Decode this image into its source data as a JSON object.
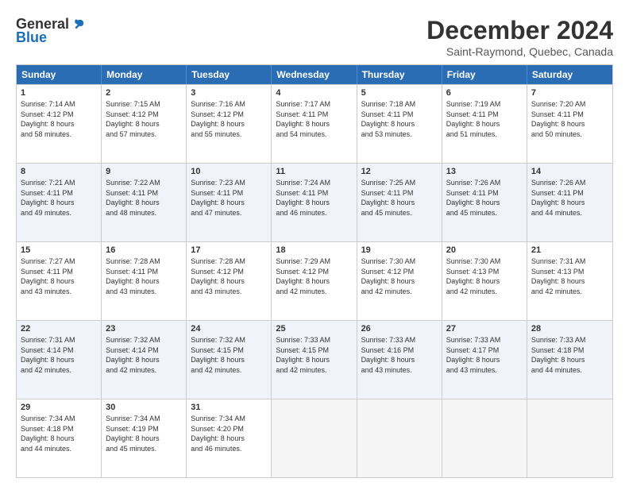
{
  "logo": {
    "general": "General",
    "blue": "Blue"
  },
  "title": "December 2024",
  "location": "Saint-Raymond, Quebec, Canada",
  "header_days": [
    "Sunday",
    "Monday",
    "Tuesday",
    "Wednesday",
    "Thursday",
    "Friday",
    "Saturday"
  ],
  "weeks": [
    [
      {
        "day": "1",
        "lines": [
          "Sunrise: 7:14 AM",
          "Sunset: 4:12 PM",
          "Daylight: 8 hours",
          "and 58 minutes."
        ]
      },
      {
        "day": "2",
        "lines": [
          "Sunrise: 7:15 AM",
          "Sunset: 4:12 PM",
          "Daylight: 8 hours",
          "and 57 minutes."
        ]
      },
      {
        "day": "3",
        "lines": [
          "Sunrise: 7:16 AM",
          "Sunset: 4:12 PM",
          "Daylight: 8 hours",
          "and 55 minutes."
        ]
      },
      {
        "day": "4",
        "lines": [
          "Sunrise: 7:17 AM",
          "Sunset: 4:11 PM",
          "Daylight: 8 hours",
          "and 54 minutes."
        ]
      },
      {
        "day": "5",
        "lines": [
          "Sunrise: 7:18 AM",
          "Sunset: 4:11 PM",
          "Daylight: 8 hours",
          "and 53 minutes."
        ]
      },
      {
        "day": "6",
        "lines": [
          "Sunrise: 7:19 AM",
          "Sunset: 4:11 PM",
          "Daylight: 8 hours",
          "and 51 minutes."
        ]
      },
      {
        "day": "7",
        "lines": [
          "Sunrise: 7:20 AM",
          "Sunset: 4:11 PM",
          "Daylight: 8 hours",
          "and 50 minutes."
        ]
      }
    ],
    [
      {
        "day": "8",
        "lines": [
          "Sunrise: 7:21 AM",
          "Sunset: 4:11 PM",
          "Daylight: 8 hours",
          "and 49 minutes."
        ]
      },
      {
        "day": "9",
        "lines": [
          "Sunrise: 7:22 AM",
          "Sunset: 4:11 PM",
          "Daylight: 8 hours",
          "and 48 minutes."
        ]
      },
      {
        "day": "10",
        "lines": [
          "Sunrise: 7:23 AM",
          "Sunset: 4:11 PM",
          "Daylight: 8 hours",
          "and 47 minutes."
        ]
      },
      {
        "day": "11",
        "lines": [
          "Sunrise: 7:24 AM",
          "Sunset: 4:11 PM",
          "Daylight: 8 hours",
          "and 46 minutes."
        ]
      },
      {
        "day": "12",
        "lines": [
          "Sunrise: 7:25 AM",
          "Sunset: 4:11 PM",
          "Daylight: 8 hours",
          "and 45 minutes."
        ]
      },
      {
        "day": "13",
        "lines": [
          "Sunrise: 7:26 AM",
          "Sunset: 4:11 PM",
          "Daylight: 8 hours",
          "and 45 minutes."
        ]
      },
      {
        "day": "14",
        "lines": [
          "Sunrise: 7:26 AM",
          "Sunset: 4:11 PM",
          "Daylight: 8 hours",
          "and 44 minutes."
        ]
      }
    ],
    [
      {
        "day": "15",
        "lines": [
          "Sunrise: 7:27 AM",
          "Sunset: 4:11 PM",
          "Daylight: 8 hours",
          "and 43 minutes."
        ]
      },
      {
        "day": "16",
        "lines": [
          "Sunrise: 7:28 AM",
          "Sunset: 4:11 PM",
          "Daylight: 8 hours",
          "and 43 minutes."
        ]
      },
      {
        "day": "17",
        "lines": [
          "Sunrise: 7:28 AM",
          "Sunset: 4:12 PM",
          "Daylight: 8 hours",
          "and 43 minutes."
        ]
      },
      {
        "day": "18",
        "lines": [
          "Sunrise: 7:29 AM",
          "Sunset: 4:12 PM",
          "Daylight: 8 hours",
          "and 42 minutes."
        ]
      },
      {
        "day": "19",
        "lines": [
          "Sunrise: 7:30 AM",
          "Sunset: 4:12 PM",
          "Daylight: 8 hours",
          "and 42 minutes."
        ]
      },
      {
        "day": "20",
        "lines": [
          "Sunrise: 7:30 AM",
          "Sunset: 4:13 PM",
          "Daylight: 8 hours",
          "and 42 minutes."
        ]
      },
      {
        "day": "21",
        "lines": [
          "Sunrise: 7:31 AM",
          "Sunset: 4:13 PM",
          "Daylight: 8 hours",
          "and 42 minutes."
        ]
      }
    ],
    [
      {
        "day": "22",
        "lines": [
          "Sunrise: 7:31 AM",
          "Sunset: 4:14 PM",
          "Daylight: 8 hours",
          "and 42 minutes."
        ]
      },
      {
        "day": "23",
        "lines": [
          "Sunrise: 7:32 AM",
          "Sunset: 4:14 PM",
          "Daylight: 8 hours",
          "and 42 minutes."
        ]
      },
      {
        "day": "24",
        "lines": [
          "Sunrise: 7:32 AM",
          "Sunset: 4:15 PM",
          "Daylight: 8 hours",
          "and 42 minutes."
        ]
      },
      {
        "day": "25",
        "lines": [
          "Sunrise: 7:33 AM",
          "Sunset: 4:15 PM",
          "Daylight: 8 hours",
          "and 42 minutes."
        ]
      },
      {
        "day": "26",
        "lines": [
          "Sunrise: 7:33 AM",
          "Sunset: 4:16 PM",
          "Daylight: 8 hours",
          "and 43 minutes."
        ]
      },
      {
        "day": "27",
        "lines": [
          "Sunrise: 7:33 AM",
          "Sunset: 4:17 PM",
          "Daylight: 8 hours",
          "and 43 minutes."
        ]
      },
      {
        "day": "28",
        "lines": [
          "Sunrise: 7:33 AM",
          "Sunset: 4:18 PM",
          "Daylight: 8 hours",
          "and 44 minutes."
        ]
      }
    ],
    [
      {
        "day": "29",
        "lines": [
          "Sunrise: 7:34 AM",
          "Sunset: 4:18 PM",
          "Daylight: 8 hours",
          "and 44 minutes."
        ]
      },
      {
        "day": "30",
        "lines": [
          "Sunrise: 7:34 AM",
          "Sunset: 4:19 PM",
          "Daylight: 8 hours",
          "and 45 minutes."
        ]
      },
      {
        "day": "31",
        "lines": [
          "Sunrise: 7:34 AM",
          "Sunset: 4:20 PM",
          "Daylight: 8 hours",
          "and 46 minutes."
        ]
      },
      {
        "day": "",
        "lines": []
      },
      {
        "day": "",
        "lines": []
      },
      {
        "day": "",
        "lines": []
      },
      {
        "day": "",
        "lines": []
      }
    ]
  ]
}
